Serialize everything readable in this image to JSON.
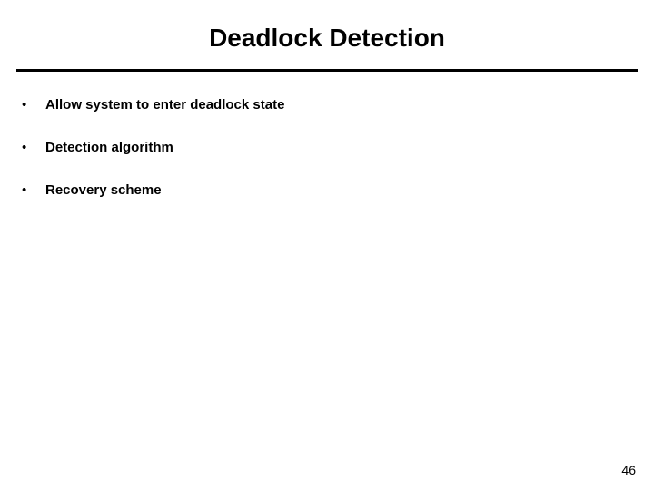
{
  "title": "Deadlock Detection",
  "bullets": [
    {
      "text": "Allow system to enter deadlock state"
    },
    {
      "text": "Detection algorithm"
    },
    {
      "text": "Recovery scheme"
    }
  ],
  "pageNumber": "46"
}
